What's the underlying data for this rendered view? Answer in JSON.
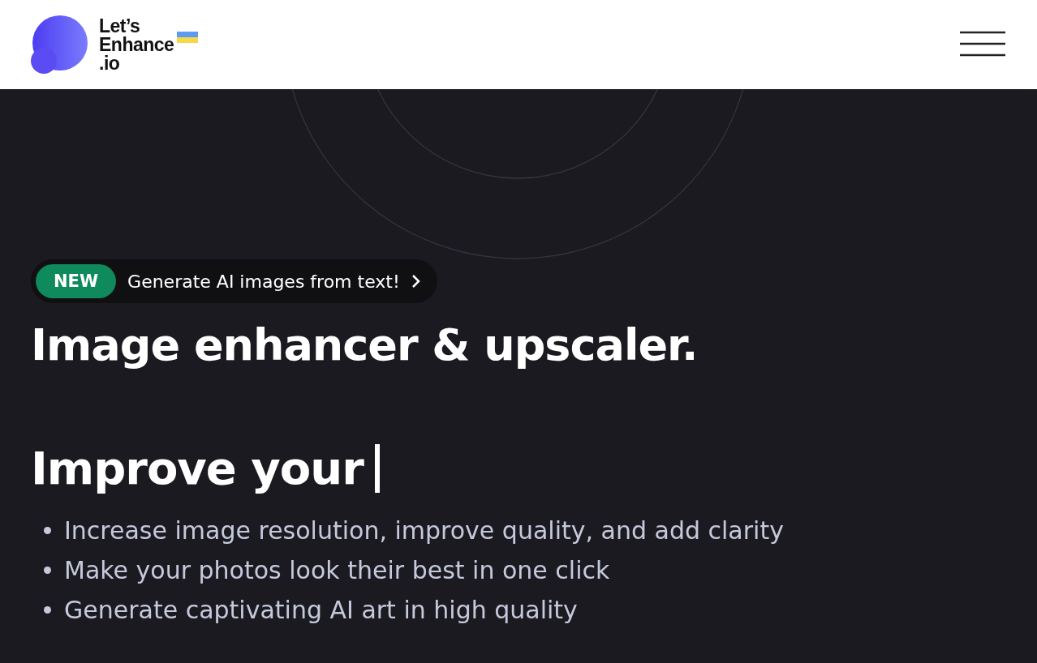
{
  "header": {
    "logo_lines": [
      "Let’s",
      "Enhance",
      ".io"
    ]
  },
  "hero": {
    "announcement": {
      "badge": "NEW",
      "text": "Generate AI images from text!"
    },
    "title": "Image enhancer & upscaler.",
    "typing_line": "Improve your",
    "bullets": [
      "Increase image resolution, improve quality, and add clarity",
      "Make your photos look their best in one click",
      "Generate captivating AI art in high quality"
    ]
  }
}
